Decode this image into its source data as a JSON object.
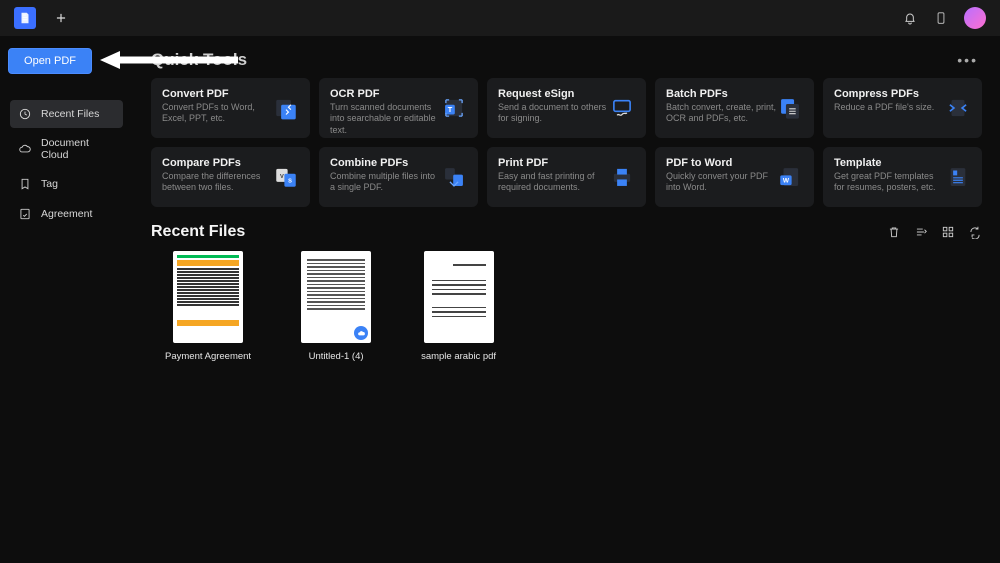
{
  "titlebar": {
    "plus": "+"
  },
  "sidebar": {
    "open_label": "Open PDF",
    "items": [
      {
        "label": "Recent Files"
      },
      {
        "label": "Document Cloud"
      },
      {
        "label": "Tag"
      },
      {
        "label": "Agreement"
      }
    ]
  },
  "main": {
    "quick_title": "Quick Tools",
    "tools": [
      {
        "title": "Convert PDF",
        "desc": "Convert PDFs to Word, Excel, PPT, etc."
      },
      {
        "title": "OCR PDF",
        "desc": "Turn scanned documents into searchable or editable text."
      },
      {
        "title": "Request eSign",
        "desc": "Send a document to others for signing."
      },
      {
        "title": "Batch PDFs",
        "desc": "Batch convert, create, print, OCR and PDFs, etc."
      },
      {
        "title": "Compress PDFs",
        "desc": "Reduce a PDF file's size."
      },
      {
        "title": "Compare PDFs",
        "desc": "Compare the differences between two files."
      },
      {
        "title": "Combine PDFs",
        "desc": "Combine multiple files into a single PDF."
      },
      {
        "title": "Print PDF",
        "desc": "Easy and fast printing of required documents."
      },
      {
        "title": "PDF to Word",
        "desc": "Quickly convert your PDF into Word."
      },
      {
        "title": "Template",
        "desc": "Get great PDF templates for resumes, posters, etc."
      }
    ],
    "recent_title": "Recent Files",
    "recent_files": [
      {
        "name": "Payment Agreement"
      },
      {
        "name": "Untitled-1 (4)"
      },
      {
        "name": "sample arabic pdf"
      }
    ]
  }
}
